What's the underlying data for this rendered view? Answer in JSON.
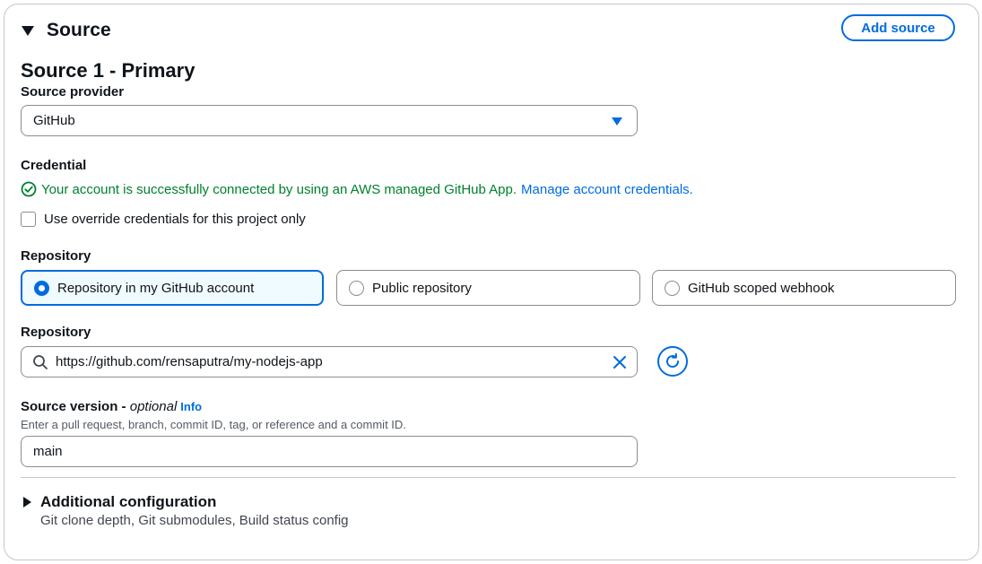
{
  "section": {
    "title": "Source",
    "add_button": "Add source"
  },
  "source_heading": "Source 1 - Primary",
  "provider": {
    "label": "Source provider",
    "value": "GitHub"
  },
  "credential": {
    "label": "Credential",
    "status": "Your account is successfully connected by using an AWS managed GitHub App.",
    "manage_link": "Manage account credentials.",
    "override_label": "Use override credentials for this project only",
    "override_checked": false
  },
  "repository_type": {
    "label": "Repository",
    "options": [
      {
        "label": "Repository in my GitHub account",
        "selected": true
      },
      {
        "label": "Public repository",
        "selected": false
      },
      {
        "label": "GitHub scoped webhook",
        "selected": false
      }
    ]
  },
  "repository": {
    "label": "Repository",
    "value": "https://github.com/rensaputra/my-nodejs-app"
  },
  "source_version": {
    "label": "Source version",
    "optional": "optional",
    "info": "Info",
    "description": "Enter a pull request, branch, commit ID, tag, or reference and a commit ID.",
    "value": "main"
  },
  "additional": {
    "title": "Additional configuration",
    "description": "Git clone depth, Git submodules, Build status config"
  },
  "colors": {
    "accent": "#006ce0",
    "success": "#00802f",
    "border": "#8c8c94"
  },
  "icons": {
    "status": "check-circle-icon",
    "search": "search-icon",
    "clear": "close-icon",
    "refresh": "refresh-icon"
  }
}
